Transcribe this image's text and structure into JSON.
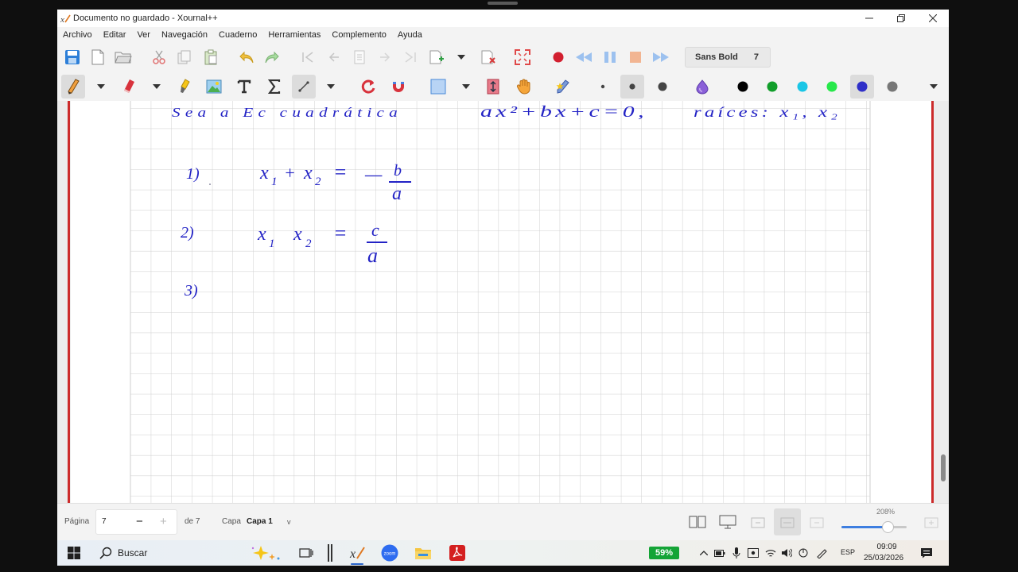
{
  "window": {
    "title": "Documento no guardado - Xournal++"
  },
  "menu": [
    "Archivo",
    "Editar",
    "Ver",
    "Navegación",
    "Cuaderno",
    "Herramientas",
    "Complemento",
    "Ayuda"
  ],
  "toolbar": {
    "font_name": "Sans Bold",
    "font_size": "7"
  },
  "colors": {
    "palette": [
      "#000000",
      "#119e2a",
      "#1ac6e6",
      "#27e84a",
      "#2f2fc8",
      "#777777"
    ],
    "selected": "#2f2fc8",
    "ink": "#2323c5",
    "grid": "#c8c8c8",
    "margin_line": "#cc2b2b"
  },
  "note": {
    "header_left": "Sea a Ec cuadrática",
    "header_eq": "ax²+bx+c=0,",
    "header_right": "raíces: x₁, x₂",
    "items": [
      {
        "num": "1)",
        "lhs_var1": "x",
        "lhs_sub1": "1",
        "op": "+",
        "lhs_var2": "x",
        "lhs_sub2": "2",
        "eq": "=",
        "sign": "—",
        "num_frac": "b",
        "den_frac": "a"
      },
      {
        "num": "2)",
        "lhs_var1": "x",
        "lhs_sub1": "1",
        "lhs_var2": "x",
        "lhs_sub2": "2",
        "eq": "=",
        "num_frac": "c",
        "den_frac": "a"
      },
      {
        "num": "3)"
      }
    ]
  },
  "status": {
    "page_label": "Página",
    "page_value": "7",
    "of_label": "de 7",
    "layer_label": "Capa",
    "layer_value": "Capa 1",
    "zoom": "208%",
    "zoom_fraction": 0.69
  },
  "taskbar": {
    "search_text": "Buscar",
    "battery": "59%",
    "language": "ESP",
    "time": "09:09",
    "date": "25/03/2026"
  }
}
